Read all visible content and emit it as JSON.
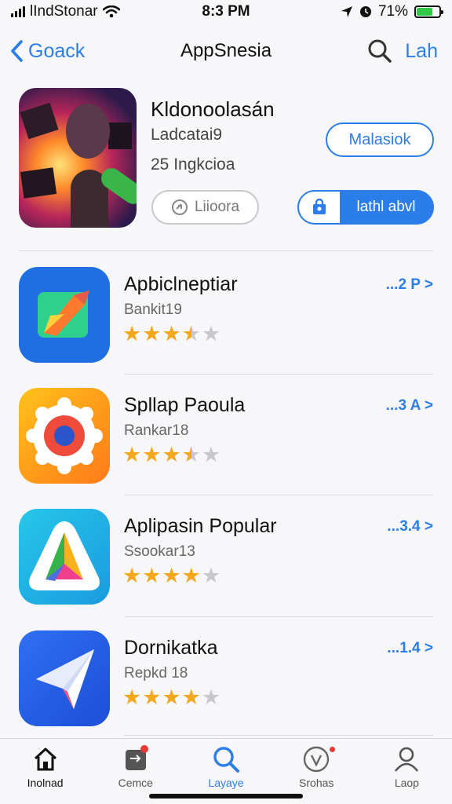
{
  "status_bar": {
    "carrier": "lIndStonar",
    "time": "8:3 PM",
    "battery_percent": "71%",
    "battery_level": 0.71
  },
  "nav": {
    "back_label": "Goack",
    "title": "AppSnesia",
    "right_label": "Lah"
  },
  "featured": {
    "title": "Kldonoolasán",
    "subtitle1": "Ladcatai9",
    "subtitle2": "25 Ingkcioa",
    "outline_button": "Malasiok",
    "secondary_button": "Liioora",
    "install_button": "lathl abvl"
  },
  "apps": [
    {
      "name": "Apbiclneptiar",
      "sub": "Bankit19",
      "rating": 3.5,
      "link": "...2 P"
    },
    {
      "name": "Spllap Paoula",
      "sub": "Rankar18",
      "rating": 3.5,
      "link": "...3 A"
    },
    {
      "name": "Aplipasin Popular",
      "sub": "Ssookar13",
      "rating": 4,
      "link": "...3.4"
    },
    {
      "name": "Dornikatka",
      "sub": "Repkd 18",
      "rating": 4,
      "link": "...1.4"
    }
  ],
  "tabs": [
    {
      "label": "Inolnad",
      "icon": "home-icon"
    },
    {
      "label": "Cemce",
      "icon": "games-icon"
    },
    {
      "label": "Layaye",
      "icon": "search-icon"
    },
    {
      "label": "Srohas",
      "icon": "arcade-icon"
    },
    {
      "label": "Laop",
      "icon": "account-icon"
    }
  ],
  "colors": {
    "accent": "#2b7de9",
    "star": "#f3a81c",
    "badge": "#e53935"
  }
}
